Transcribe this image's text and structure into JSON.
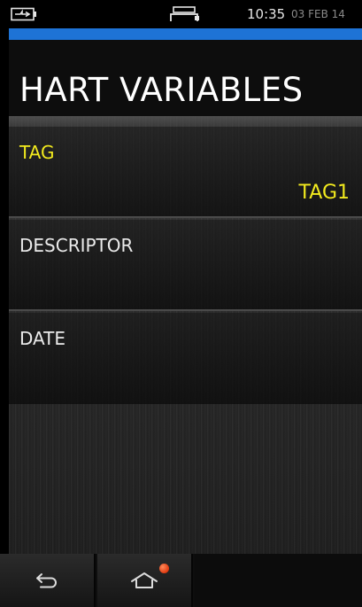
{
  "status_bar": {
    "battery_icon": "battery-charging-icon",
    "connection_icon": "usb-connector-icon",
    "time": "10:35",
    "date": "03 FEB 14"
  },
  "header": {
    "title": "HART VARIABLES"
  },
  "list": {
    "items": [
      {
        "label": "TAG",
        "value": "TAG1"
      },
      {
        "label": "DESCRIPTOR",
        "value": ""
      },
      {
        "label": "DATE",
        "value": ""
      }
    ]
  },
  "nav_bar": {
    "back_icon": "back-arrow-icon",
    "home_icon": "home-icon",
    "home_notification": "notification-dot-icon"
  },
  "colors": {
    "accent_blue": "#1e73d6",
    "highlight_yellow": "#f2ea1e",
    "notification_red": "#e03a10"
  }
}
